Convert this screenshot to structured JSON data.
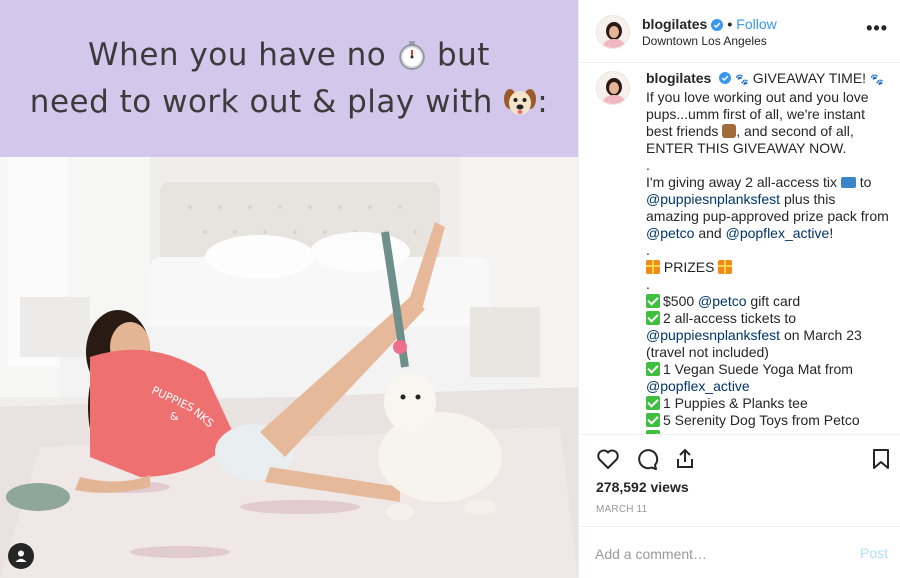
{
  "media": {
    "banner_line1": "When you have no",
    "banner_line1_after": "but",
    "banner_line2": "need to work out & play with",
    "banner_line2_after": ":",
    "stopwatch_emoji": "stopwatch-icon",
    "dog_emoji": "dog-face-icon",
    "shirt_text_1": "PUPPIES",
    "shirt_text_2": "&",
    "shirt_text_3": "NKS"
  },
  "header": {
    "username": "blogilates",
    "separator": "•",
    "follow_label": "Follow",
    "location": "Downtown Los Angeles",
    "more_label": "•••"
  },
  "caption": {
    "username": "blogilates",
    "line_giveaway": "GIVEAWAY TIME!",
    "p1_a": "If you love working out and you love pups...umm first of all, we're instant best friends",
    "p1_b": ", and second of all, ENTER THIS GIVEAWAY NOW.",
    "dot1": ".",
    "p2_a": "I'm giving away 2 all-access tix",
    "p2_b": "to",
    "mention_fest": "@puppiesnplanksfest",
    "p2_c": "plus this amazing pup-approved prize pack from",
    "mention_petco": "@petco",
    "p2_d": "and",
    "mention_popflex": "@popflex_active",
    "p2_e": "!",
    "dot2": ".",
    "prizes_label": "PRIZES",
    "dot3": ".",
    "prize1_a": "$500",
    "prize1_mention": "@petco",
    "prize1_b": "gift card",
    "prize2_a": "2 all-access tickets to",
    "prize2_mention": "@puppiesnplanksfest",
    "prize2_b": "on March 23 (travel not included)",
    "prize3_a": "1 Vegan Suede Yoga Mat from",
    "prize3_mention": "@popflex_active",
    "prize4": "1 Puppies & Planks tee",
    "prize5": "5 Serenity Dog Toys from Petco"
  },
  "stats": {
    "views": "278,592 views",
    "date": "MARCH 11"
  },
  "comment": {
    "placeholder": "Add a comment…",
    "post_label": "Post"
  },
  "colors": {
    "banner_bg": "#d4c7ec",
    "link_blue": "#3897f0",
    "mention": "#003569",
    "post_disabled": "#b2dffc"
  }
}
